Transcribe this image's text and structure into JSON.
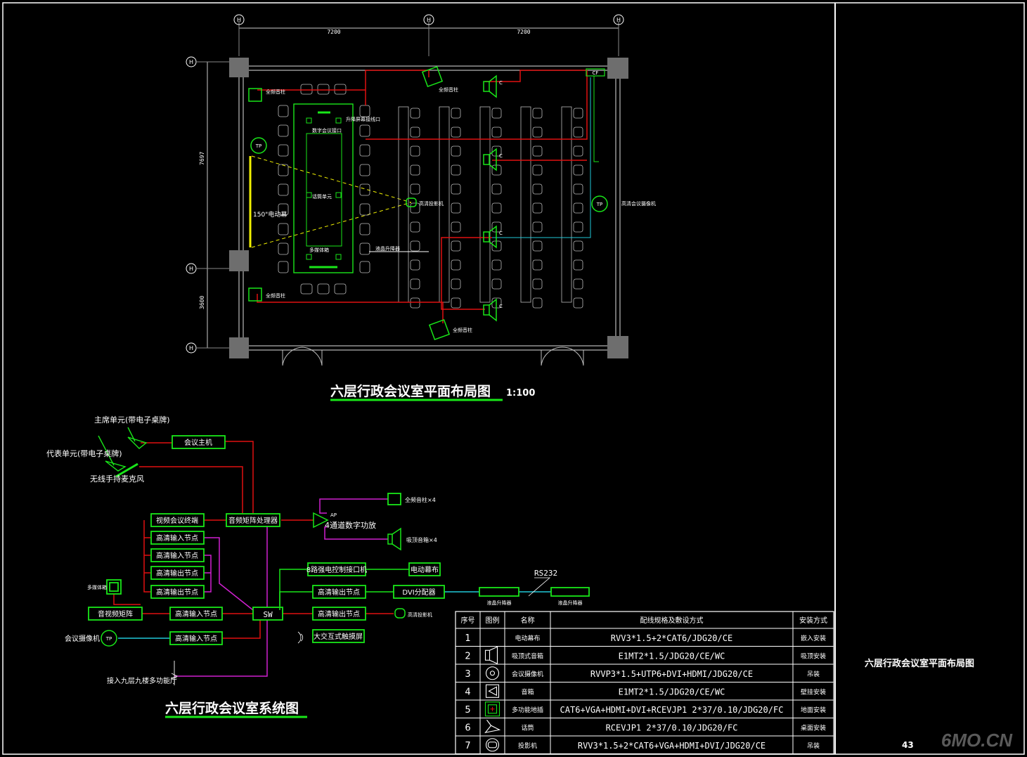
{
  "floor_plan": {
    "title": "六层行政会议室平面布局图",
    "scale": "1:100",
    "grid_labels": [
      "H",
      "H",
      "H",
      "H",
      "H",
      "H"
    ],
    "dim_top": [
      "7200",
      "7200"
    ],
    "dim_left": [
      "7697",
      "3600"
    ],
    "labels": {
      "speaker_top_left": "全频音柱",
      "speaker_top_mid": "全频音柱",
      "speaker_bottom_left": "全频音柱",
      "speaker_bottom_mid": "全频音柱",
      "desk_interface": "数字会议接口",
      "lift_interface": "升降屏幕接线口",
      "projector": "高清投影机",
      "wireless_mic": "话筒单元",
      "floor_box": "多媒体箱",
      "screen_150": "150\"电动幕",
      "lcd_lift": "液晶升降器",
      "camera_right": "高清会议摄像机",
      "cf": "CF",
      "c1": "C",
      "c2": "C",
      "c3": "C",
      "c4": "C"
    }
  },
  "system": {
    "title": "六层行政会议室系统图",
    "chair_unit": "主席单元(带电子桌牌)",
    "delegate_unit": "代表单元(带电子桌牌)",
    "wireless_mic": "无线手持麦克风",
    "conf_host": "会议主机",
    "audio_matrix": "音频矩阵处理器",
    "video_terminal": "视频会议终端",
    "hd_in_1": "高清输入节点",
    "hd_in_2": "高清输入节点",
    "hd_out_1": "高清输出节点",
    "hd_out_2": "高清输出节点",
    "amp": "4通道数字功放",
    "amp_tag": "AP",
    "spk_full": "全频音柱×4",
    "spk_ceiling": "吸顶音箱×4",
    "relay": "8路强电控制接口机",
    "motor_screen": "电动幕布",
    "hd_out_3": "高清输出节点",
    "dvi_split": "DVI分配器",
    "rs232": "RS232",
    "lcd_lift_1": "液晶升降器",
    "lcd_lift_2": "液晶升降器",
    "floor_box": "多媒体箱",
    "av_matrix": "音视频矩阵",
    "hd_in_3": "高清输入节点",
    "sw": "SW",
    "hd_out_4": "高清输出节点",
    "projector": "高清投影机",
    "camera": "会议摄像机",
    "hd_in_4": "高清输入节点",
    "touch": "大交互式触摸屏",
    "ninth_floor": "接入九层九楼多功能厅"
  },
  "legend_table": {
    "headers": [
      "序号",
      "图例",
      "名称",
      "配线规格及敷设方式",
      "安装方式"
    ],
    "rows": [
      {
        "no": "1",
        "name": "电动幕布",
        "spec": "RVV3*1.5+2*CAT6/JDG20/CE",
        "install": "嵌入安装"
      },
      {
        "no": "2",
        "name": "吸顶式音箱",
        "spec": "E1MT2*1.5/JDG20/CE/WC",
        "install": "吸顶安装"
      },
      {
        "no": "3",
        "name": "会议摄像机",
        "spec": "RVVP3*1.5+UTP6+DVI+HDMI/JDG20/CE",
        "install": "吊装"
      },
      {
        "no": "4",
        "name": "音箱",
        "spec": "E1MT2*1.5/JDG20/CE/WC",
        "install": "壁挂安装"
      },
      {
        "no": "5",
        "name": "多功能地插",
        "spec": "CAT6+VGA+HDMI+DVI+RCEVJP1 2*37/0.10/JDG20/FC",
        "install": "地面安装"
      },
      {
        "no": "6",
        "name": "话筒",
        "spec": "RCEVJP1 2*37/0.10/JDG20/FC",
        "install": "桌面安装"
      },
      {
        "no": "7",
        "name": "投影机",
        "spec": "RVV3*1.5+2*CAT6+VGA+HDMI+DVI/JDG20/CE",
        "install": "吊装"
      }
    ]
  },
  "title_block": {
    "drawing_name": "六层行政会议室平面布局图",
    "page_number": "43",
    "watermark": "6MO.CN"
  },
  "colors": {
    "line_red": "#e01010",
    "line_green": "#19e619",
    "line_magenta": "#d020d0",
    "line_cyan": "#20c8d8",
    "line_yellow": "#f0f000",
    "wall_gray": "#6e6e6e",
    "text_white": "#ffffff"
  }
}
